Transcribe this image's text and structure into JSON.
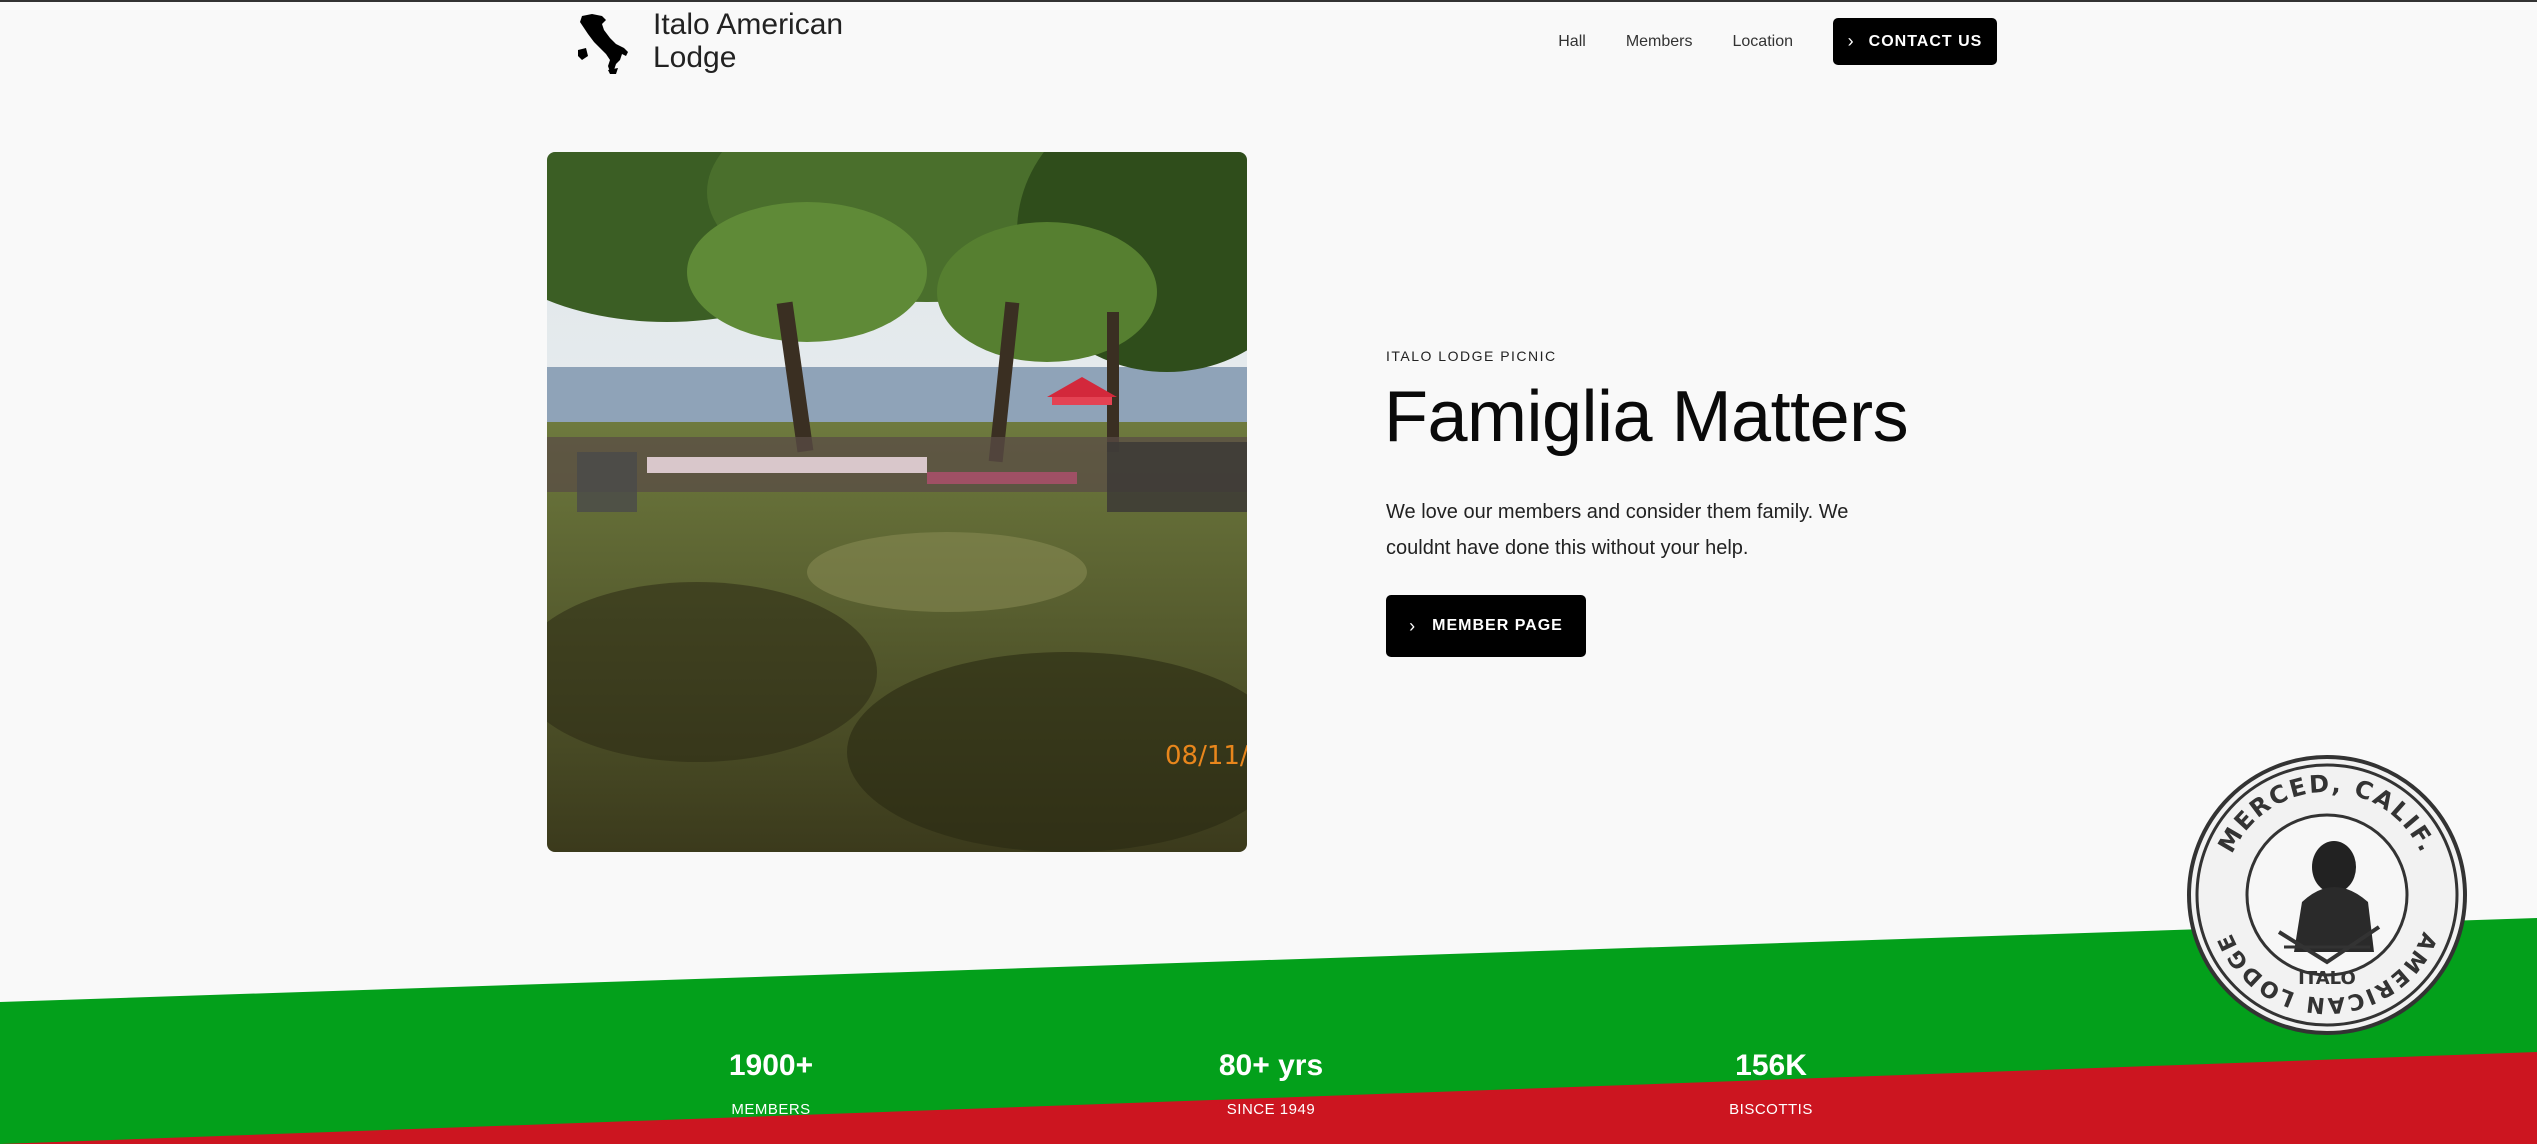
{
  "header": {
    "brand": "Italo American Lodge",
    "logo_icon": "italy-map-icon",
    "nav": [
      {
        "label": "Hall"
      },
      {
        "label": "Members"
      },
      {
        "label": "Location"
      }
    ],
    "contact_label": "CONTACT US"
  },
  "hero": {
    "photo_date_stamp": "08/11/",
    "kicker": "ITALO LODGE PICNIC",
    "title": "Famiglia Matters",
    "description": "We love our members and consider them family. We couldnt have done this without your help.",
    "button_label": "MEMBER PAGE"
  },
  "stats": [
    {
      "value": "1900+",
      "label": "MEMBERS"
    },
    {
      "value": "80+ yrs",
      "label": "SINCE 1949"
    },
    {
      "value": "156K",
      "label": "BISCOTTIS"
    }
  ],
  "seal": {
    "text_top": "MERCED, CALIF.",
    "text_left": "AMERICAN LODGE",
    "text_bottom": "ITALO"
  },
  "colors": {
    "green": "#03a01b",
    "red": "#cc1520",
    "button": "#000000",
    "background": "#f9f9f9"
  }
}
